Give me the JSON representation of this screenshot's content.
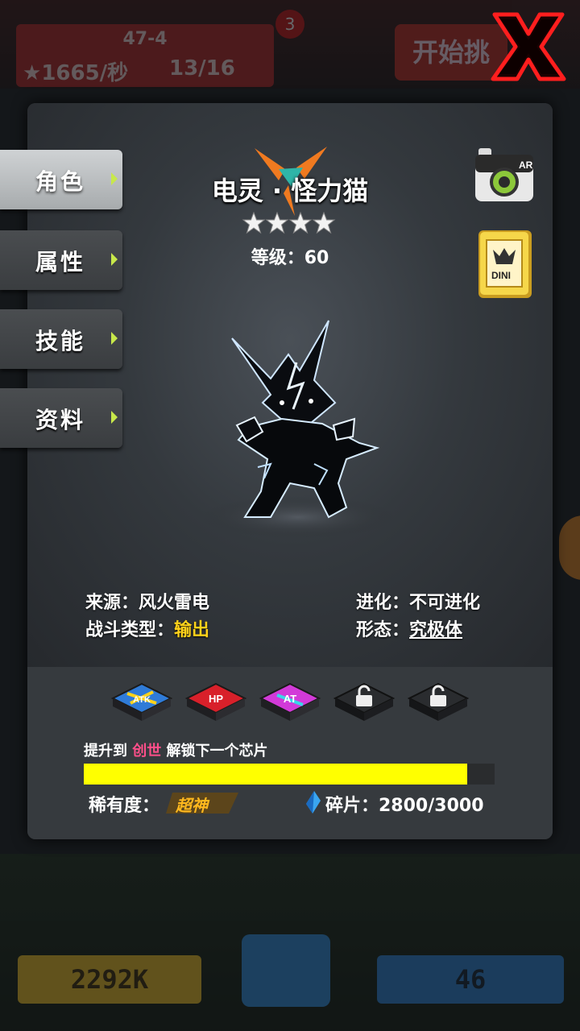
{
  "background": {
    "stage": "47-4",
    "rate": "1665/秒",
    "count": "13/16",
    "badge": "3",
    "start_button": "开始挑",
    "gold": "2292K",
    "gems": "46"
  },
  "tabs": [
    {
      "label": "角色",
      "active": true
    },
    {
      "label": "属性",
      "active": false
    },
    {
      "label": "技能",
      "active": false
    },
    {
      "label": "资料",
      "active": false
    }
  ],
  "character": {
    "name": "电灵 · 怪力猫",
    "stars": 4,
    "level": "等级：60"
  },
  "icons": {
    "ar": "AR",
    "card": "DINI"
  },
  "info": {
    "source_label": "来源：",
    "source_value": "风火雷电",
    "evolution_label": "进化：",
    "evolution_value": "不可进化",
    "battle_type_label": "战斗类型：",
    "battle_type_value": "输出",
    "form_label": "形态：",
    "form_value": "究极体"
  },
  "chips": [
    {
      "label": "ATK",
      "state": "unlocked"
    },
    {
      "label": "HP",
      "state": "unlocked"
    },
    {
      "label": "AT",
      "state": "unlocked"
    },
    {
      "label": "",
      "state": "locked"
    },
    {
      "label": "",
      "state": "locked"
    }
  ],
  "unlock": {
    "prefix": "提升到 ",
    "target": "创世",
    "suffix": " 解锁下一个芯片",
    "progress": 0.933
  },
  "rarity": {
    "label": "稀有度：",
    "value": "超神"
  },
  "shards": {
    "label": "碎片：2800/3000"
  },
  "colors": {
    "accent_yellow": "#ffd21a",
    "progress_fill": "#ffff00",
    "pink": "#ff4f8a",
    "close_red": "#e01010"
  }
}
